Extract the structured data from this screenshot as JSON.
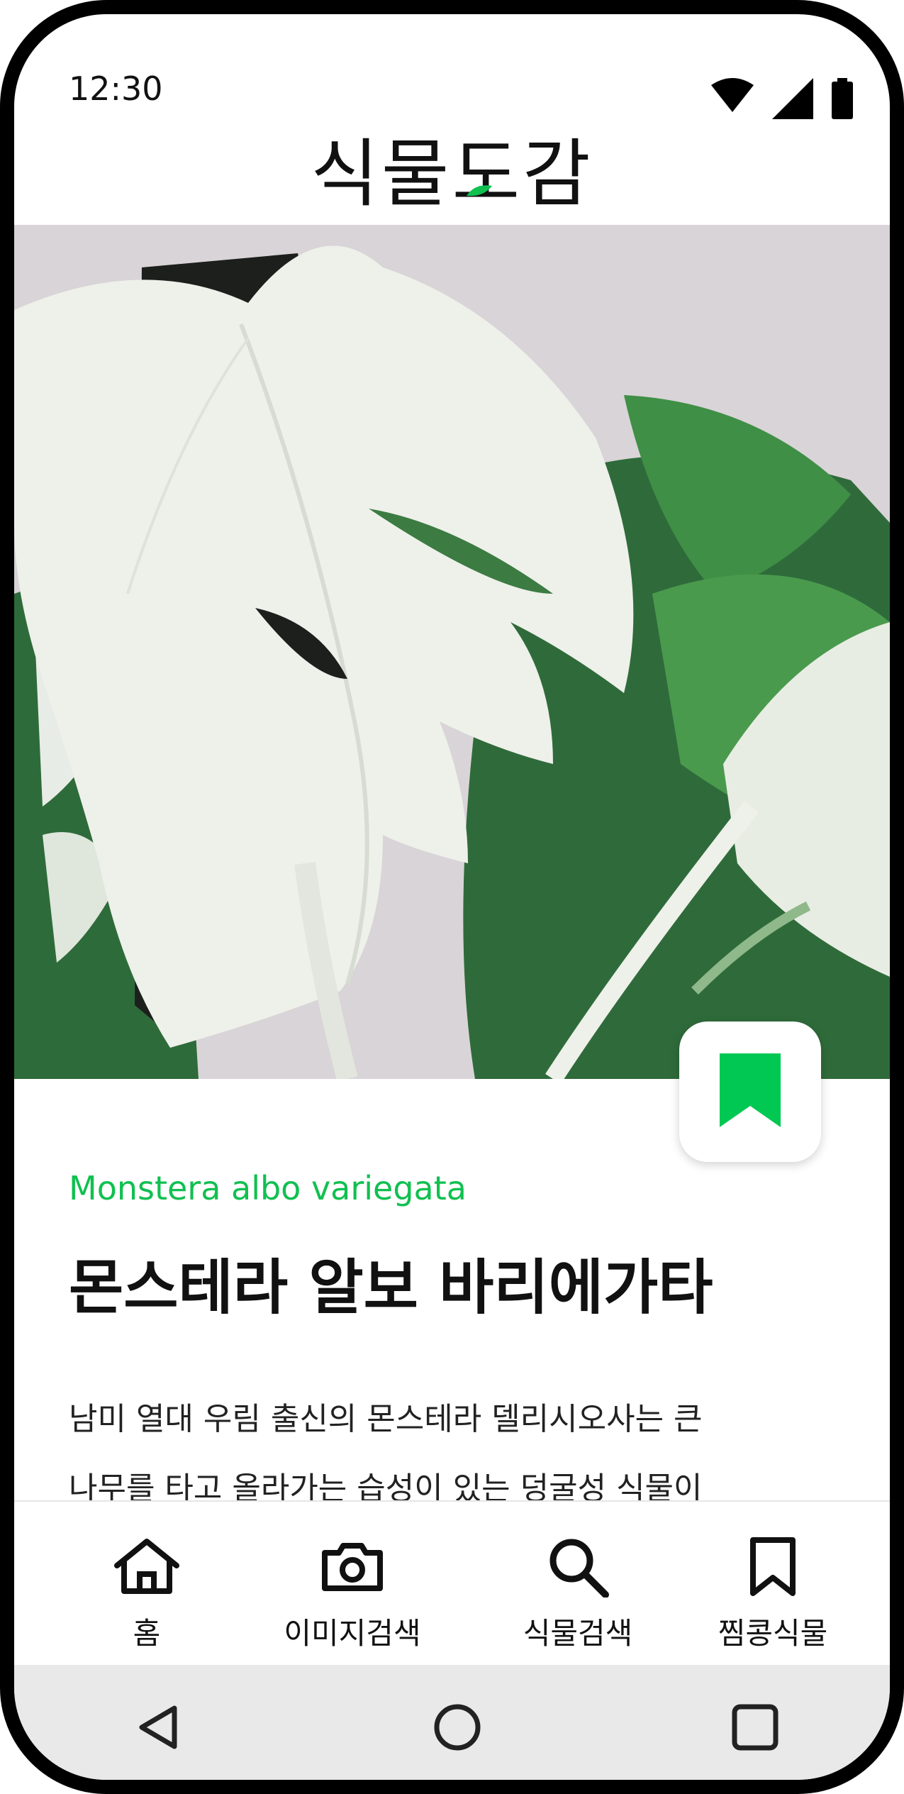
{
  "status_bar": {
    "time": "12:30",
    "icons": [
      "wifi-icon",
      "signal-icon",
      "battery-icon"
    ]
  },
  "app": {
    "title": "식물도감"
  },
  "hero": {
    "image": "variegated-monstera-leaves"
  },
  "bookmark": {
    "icon": "bookmark-filled-icon",
    "color": "#00c853",
    "active": true
  },
  "plant": {
    "scientific_name": "Monstera albo variegata",
    "korean_name": "몬스테라 알보 바리에가타",
    "description_lines": [
      "남미 열대 우림 출신의 몬스테라 델리시오사는 큰",
      "나무를 타고 올라가는 습성이 있는 덩굴성 식물이"
    ]
  },
  "bottom_nav": {
    "items": [
      {
        "label": "홈",
        "icon": "home-icon"
      },
      {
        "label": "이미지검색",
        "icon": "camera-icon"
      },
      {
        "label": "식물검색",
        "icon": "search-icon"
      },
      {
        "label": "찜콩식물",
        "icon": "bookmark-icon"
      }
    ]
  },
  "system_nav": {
    "buttons": [
      "back-icon",
      "home-circle-icon",
      "recents-icon"
    ]
  },
  "colors": {
    "accent": "#10c050",
    "text": "#111111",
    "system_nav_bg": "#e9e9e9"
  }
}
